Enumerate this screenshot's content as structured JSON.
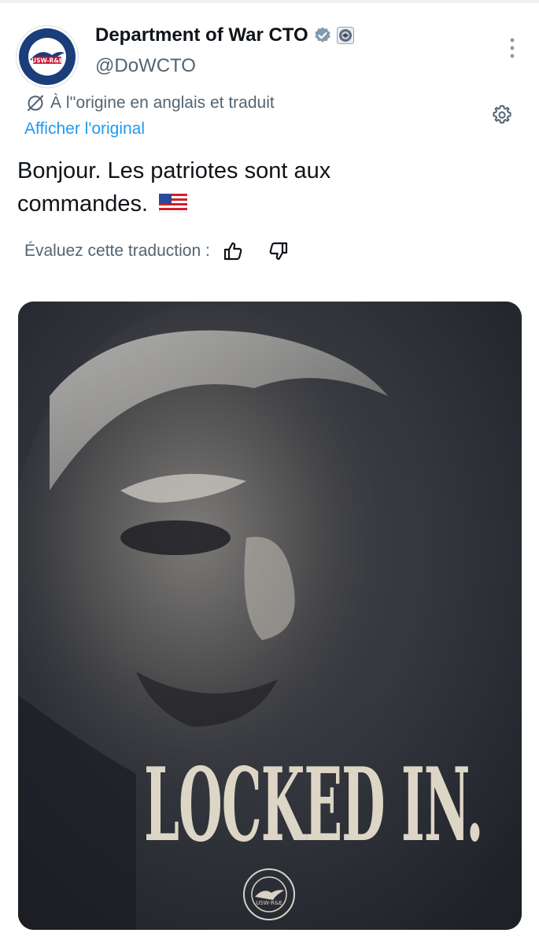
{
  "author": {
    "display_name": "Department of War CTO",
    "handle": "@DoWCTO",
    "avatar_text": "USW-R&E",
    "verified_icon": "verified-badge-icon",
    "affiliation_icon": "affiliation-seal-icon"
  },
  "translation": {
    "notice": "À l''origine en anglais et traduit",
    "show_original": "Afficher l'original",
    "rate_label": "Évaluez cette traduction :"
  },
  "tweet": {
    "text": "Bonjour. Les patriotes sont aux commandes.",
    "emoji": "us-flag-emoji"
  },
  "media": {
    "caption": "LOCKED IN.",
    "seal_text": "USW-R&E"
  },
  "colors": {
    "text": "#0f1419",
    "secondary": "#536471",
    "link": "#1d9bf0",
    "verified": "#829aab",
    "poster_background": "#2c2f37",
    "poster_text": "#ddd6c6"
  }
}
